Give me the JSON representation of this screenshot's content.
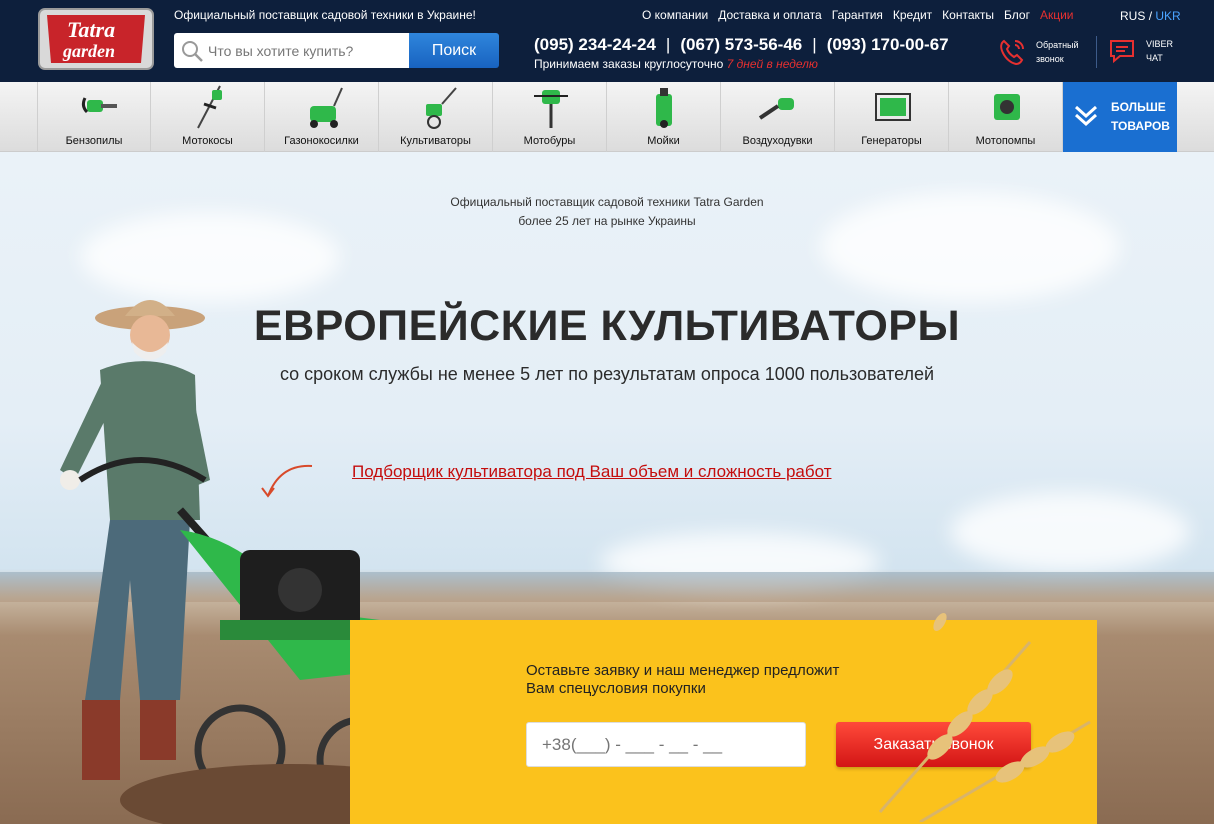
{
  "header": {
    "logo_text_1": "Tatra",
    "logo_text_2": "garden",
    "tagline": "Официальный поставщик садовой техники в Украине!",
    "search_placeholder": "Что вы хотите купить?",
    "search_button": "Поиск",
    "nav": [
      "О компании",
      "Доставка и оплата",
      "Гарантия",
      "Кредит",
      "Контакты",
      "Блог",
      "Акции"
    ],
    "lang_rus": "RUS",
    "lang_sep": "/",
    "lang_ukr": "UKR",
    "phones": [
      "(095) 234-24-24",
      "(067) 573-56-46",
      "(093) 170-00-67"
    ],
    "phone_sep": "|",
    "orders_text": "Принимаем заказы круглосуточно",
    "orders_em": "7 дней в неделю",
    "callback_line1": "Обратный",
    "callback_line2": "звонок",
    "viber_line1": "VIBER",
    "viber_line2": "ЧАТ"
  },
  "categories": [
    "Бензопилы",
    "Мотокосы",
    "Газонокосилки",
    "Культиваторы",
    "Мотобуры",
    "Мойки",
    "Воздуходувки",
    "Генераторы",
    "Мотопомпы"
  ],
  "more_button": {
    "line1": "БОЛЬШЕ",
    "line2": "ТОВАРОВ"
  },
  "hero": {
    "sub_line1": "Официальный поставщик садовой техники Tatra Garden",
    "sub_line2": "более 25 лет на рынке Украины",
    "title": "ЕВРОПЕЙСКИЕ КУЛЬТИВАТОРЫ",
    "lead": "со сроком службы не менее 5 лет по результатам опроса 1000 пользователей",
    "link": "Подборщик культиватора под Ваш объем и сложность работ"
  },
  "form": {
    "text_line1": "Оставьте заявку и наш менеджер предложит",
    "text_line2": "Вам спецусловия покупки",
    "phone_placeholder": "+38(___) - ___ - __ - __",
    "submit": "Заказать звонок"
  },
  "colors": {
    "header_bg": "#0d1f3c",
    "accent_blue": "#1a6fd1",
    "accent_red": "#e63030",
    "form_yellow": "#fbc21c",
    "product_green": "#2fb84a"
  }
}
